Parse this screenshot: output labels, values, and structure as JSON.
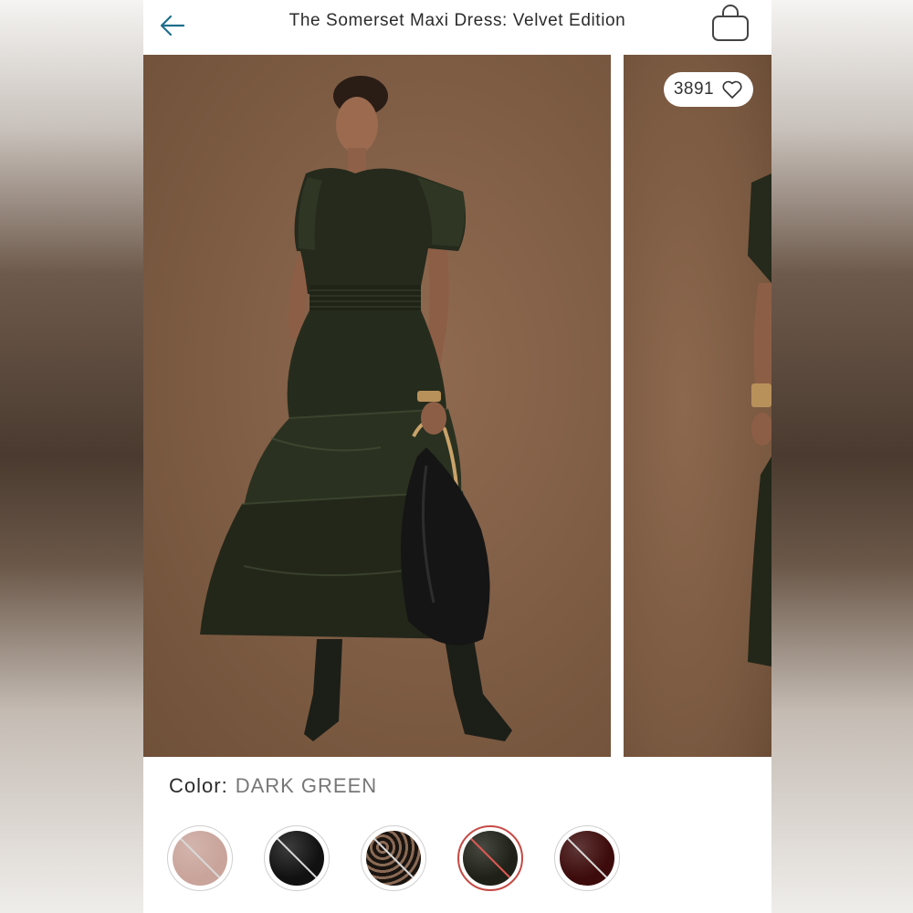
{
  "header": {
    "title": "The Somerset Maxi Dress: Velvet Edition",
    "back_icon": "back-arrow-icon",
    "bag_icon": "shopping-bag-icon"
  },
  "gallery": {
    "like_count": "3891",
    "like_icon": "heart-outline-icon",
    "images": [
      {
        "subject": "model in dark green velvet tiered maxi dress with black hobo bag"
      },
      {
        "subject": "partial next product image"
      }
    ]
  },
  "color": {
    "label": "Color:",
    "value": "DARK GREEN"
  },
  "swatches": [
    {
      "name": "blush",
      "color": "#c9a49b",
      "unavailable": true,
      "selected": false
    },
    {
      "name": "black",
      "color": "#111111",
      "unavailable": true,
      "selected": false
    },
    {
      "name": "black-lace-print",
      "color": "#3a2a22",
      "unavailable": true,
      "selected": false
    },
    {
      "name": "dark-green",
      "color": "#1f2118",
      "unavailable": true,
      "selected": true
    },
    {
      "name": "burgundy",
      "color": "#3d0b0b",
      "unavailable": true,
      "selected": false
    }
  ],
  "colors": {
    "accent": "#1f6e8c",
    "selected_ring": "#c64a44",
    "background_photo": "#7e5c44"
  }
}
